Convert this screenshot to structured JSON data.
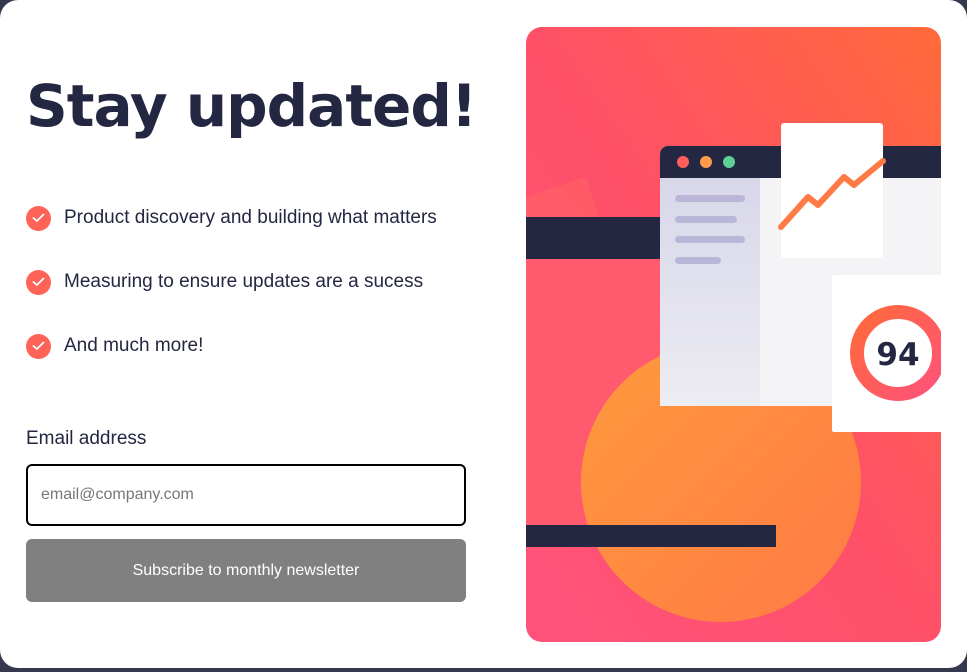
{
  "signup": {
    "title": "Stay updated!",
    "features": [
      "Product discovery and building what matters",
      "Measuring to ensure updates are a sucess",
      "And much more!"
    ],
    "email_label": "Email address",
    "email_placeholder": "email@company.com",
    "email_value": "",
    "subscribe_label": "Subscribe to monthly newsletter"
  },
  "illustration": {
    "score": "94"
  },
  "colors": {
    "accent": "#ff6257",
    "heading": "#242742",
    "button": "#808080",
    "background": "#36384e"
  },
  "icons": {
    "feature_bullet": "check-icon"
  }
}
